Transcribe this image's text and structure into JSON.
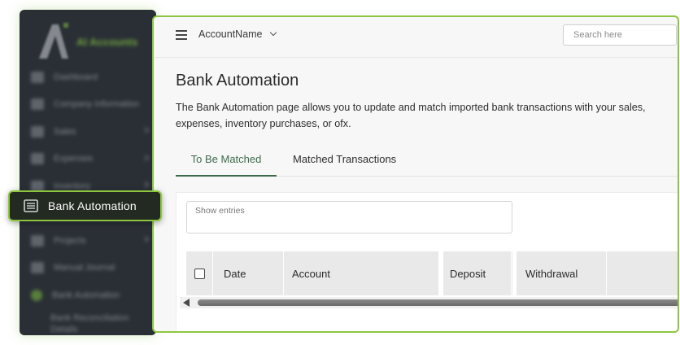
{
  "sidebar": {
    "brand": "AI Accounts",
    "items": [
      {
        "label": "Dashboard",
        "icon": "dashboard-icon",
        "has_chevron": false
      },
      {
        "label": "Company Information",
        "icon": "company-icon",
        "has_chevron": false
      },
      {
        "label": "Sales",
        "icon": "sales-icon",
        "has_chevron": true
      },
      {
        "label": "Expenses",
        "icon": "expenses-icon",
        "has_chevron": true
      },
      {
        "label": "Inventory",
        "icon": "inventory-icon",
        "has_chevron": true
      },
      {
        "label": "Projects",
        "icon": "projects-icon",
        "has_chevron": true
      },
      {
        "label": "Manual Journal",
        "icon": "journal-icon",
        "has_chevron": false
      },
      {
        "label": "Bank Automation",
        "icon": "bank-icon",
        "has_chevron": false
      }
    ],
    "sub_item": "Bank Reconciliation Details",
    "highlighted": {
      "label": "Bank Automation",
      "icon": "bank-automation-icon"
    }
  },
  "topbar": {
    "account_name": "AccountName",
    "search_placeholder": "Search here"
  },
  "page": {
    "title": "Bank Automation",
    "description": "The Bank Automation page allows you to update and match imported bank transactions with your sales, expenses, inventory purchases, or ofx."
  },
  "tabs": [
    {
      "label": "To Be Matched",
      "active": true
    },
    {
      "label": "Matched Transactions",
      "active": false
    }
  ],
  "table": {
    "show_entries_label": "Show entries",
    "columns": [
      "Date",
      "Account",
      "Deposit",
      "Withdrawal"
    ]
  },
  "colors": {
    "accent": "#8cc63f",
    "sidebar_bg": "#2a2f36",
    "active_tab": "#3d6b4a"
  }
}
